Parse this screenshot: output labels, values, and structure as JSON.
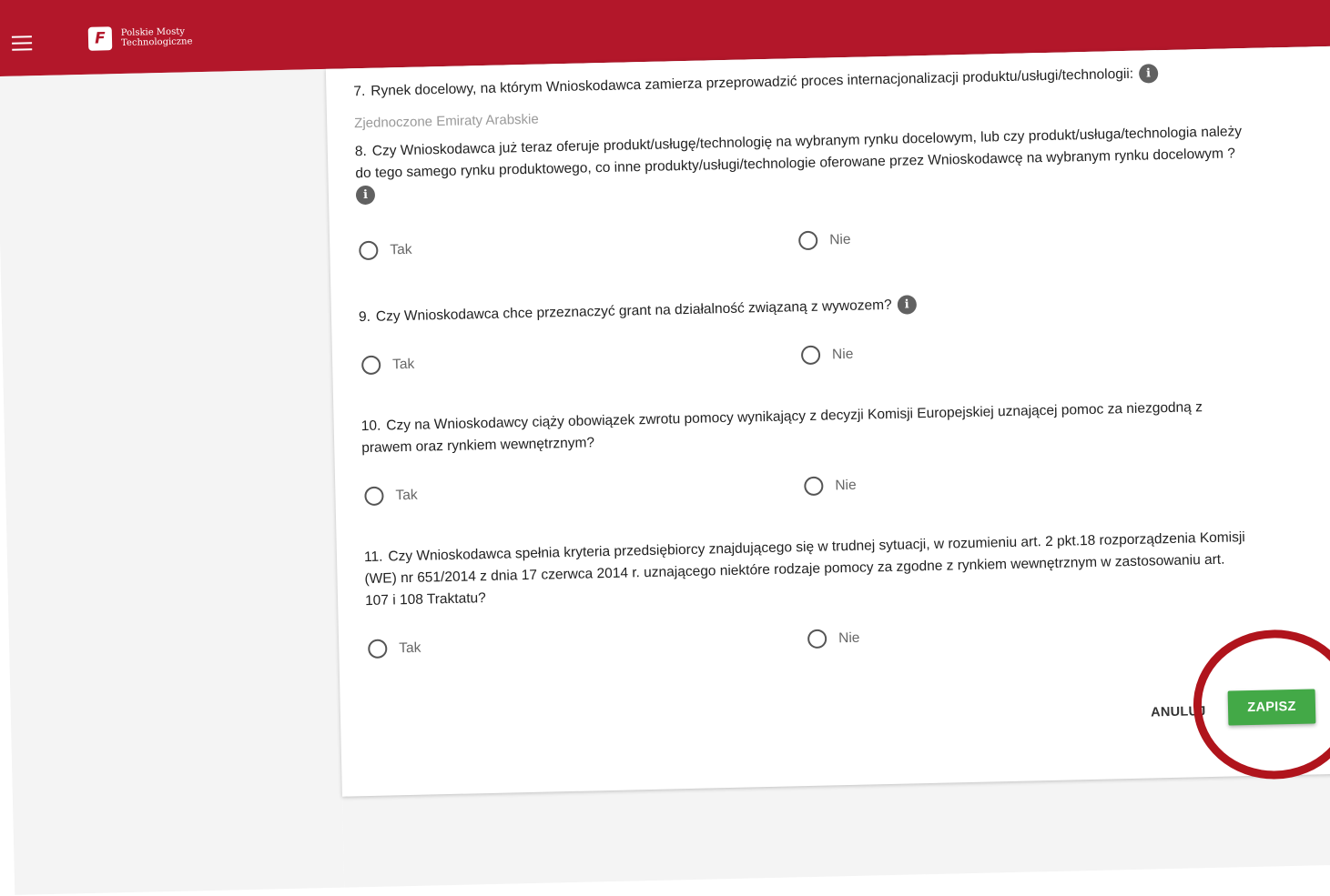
{
  "header": {
    "brand_line1": "Polskie Mosty",
    "brand_line2": "Technologiczne",
    "logo_glyph": "F"
  },
  "questions": [
    {
      "number": "7.",
      "text": "Rynek docelowy, na którym Wnioskodawca zamierza przeprowadzić proces internacjonalizacji produktu/usługi/technologii:",
      "info": "i",
      "answer": "Zjednoczone Emiraty Arabskie"
    },
    {
      "number": "8.",
      "text": "Czy Wnioskodawca już teraz oferuje produkt/usługę/technologię na wybranym rynku docelowym, lub czy produkt/usługa/technologia należy do tego samego rynku produktowego, co inne produkty/usługi/technologie oferowane przez Wnioskodawcę na wybranym rynku docelowym ?",
      "info": "i",
      "options": [
        "Tak",
        "Nie"
      ]
    },
    {
      "number": "9.",
      "text": "Czy Wnioskodawca chce przeznaczyć grant na działalność związaną z wywozem?",
      "info": "i",
      "options": [
        "Tak",
        "Nie"
      ]
    },
    {
      "number": "10.",
      "text": "Czy na Wnioskodawcy ciąży obowiązek zwrotu pomocy wynikający z decyzji Komisji Europejskiej uznającej pomoc za niezgodną z prawem oraz rynkiem wewnętrznym?",
      "options": [
        "Tak",
        "Nie"
      ]
    },
    {
      "number": "11.",
      "text": "Czy Wnioskodawca spełnia kryteria przedsiębiorcy znajdującego się w trudnej sytuacji, w rozumieniu art. 2 pkt.18 rozporządzenia Komisji (WE) nr 651/2014 z dnia 17 czerwca 2014 r. uznającego niektóre rodzaje pomocy za zgodne z rynkiem wewnętrznym w zastosowaniu art. 107 i 108 Traktatu?",
      "options": [
        "Tak",
        "Nie"
      ]
    }
  ],
  "actions": {
    "cancel_label": "ANULUJ",
    "save_label": "ZAPISZ"
  },
  "colors": {
    "brand_red": "#b3172a",
    "save_green": "#43a947",
    "highlight_circle": "#b0141c"
  }
}
